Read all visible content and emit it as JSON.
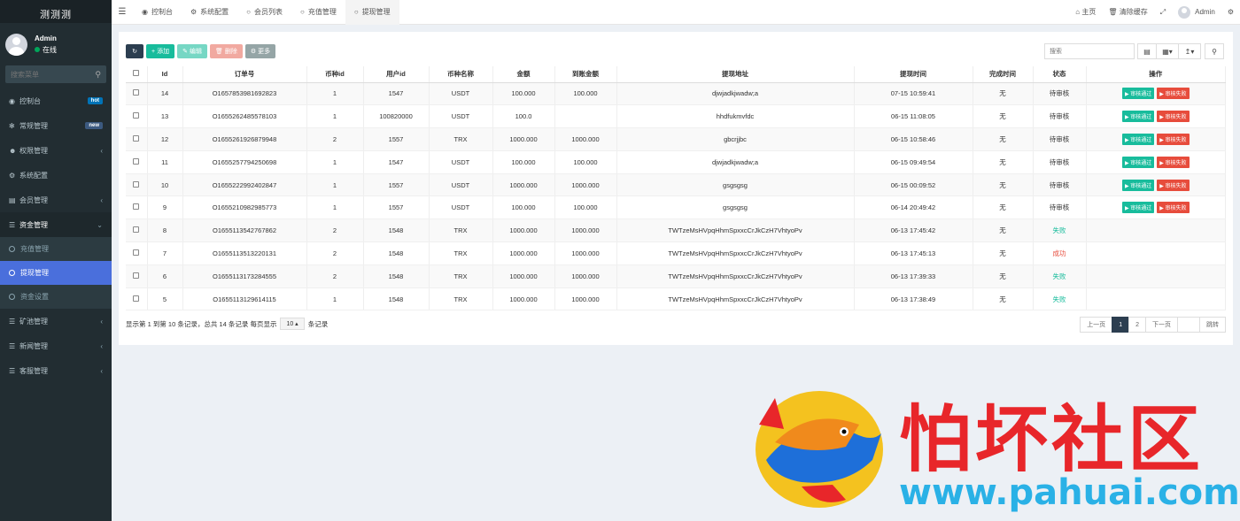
{
  "sidebar": {
    "logo": "测测测",
    "user_name": "Admin",
    "user_status": "在线",
    "search_placeholder": "搜索菜单",
    "menu": [
      {
        "label": "控制台",
        "badge": "hot"
      },
      {
        "label": "常规管理",
        "badge": "new"
      },
      {
        "label": "权限管理"
      },
      {
        "label": "系统配置"
      },
      {
        "label": "会员管理"
      },
      {
        "label": "资金管理"
      }
    ],
    "submenu": [
      "充值管理",
      "提现管理",
      "资金设置"
    ],
    "menu2": [
      "矿池管理",
      "新闻管理",
      "客服管理"
    ]
  },
  "topbar": {
    "tabs": [
      "控制台",
      "系统配置",
      "会员列表",
      "充值管理",
      "提现管理"
    ],
    "home": "主页",
    "clear_cache": "清除缓存",
    "admin": "Admin"
  },
  "toolbar": {
    "add": "添加",
    "edit": "编辑",
    "delete": "删除",
    "more": "更多",
    "search_placeholder": "搜索"
  },
  "table": {
    "headers": [
      "Id",
      "订单号",
      "币种id",
      "用户id",
      "币种名称",
      "金额",
      "到账金额",
      "提现地址",
      "提现时间",
      "完成时间",
      "状态",
      "操作"
    ],
    "rows": [
      {
        "id": "14",
        "order": "O1657853981692823",
        "coin_id": "1",
        "user_id": "1547",
        "coin": "USDT",
        "amount": "100.000",
        "received": "100.000",
        "address": "djwjadkjwadw;a",
        "time": "07-15 10:59:41",
        "done": "无",
        "status": "待审核",
        "pending": true
      },
      {
        "id": "13",
        "order": "O1655262485578103",
        "coin_id": "1",
        "user_id": "100820000",
        "coin": "USDT",
        "amount": "100.0",
        "received": "",
        "address": "hhdfukmvfdc",
        "time": "06-15 11:08:05",
        "done": "无",
        "status": "待审核",
        "pending": true
      },
      {
        "id": "12",
        "order": "O1655261926879948",
        "coin_id": "2",
        "user_id": "1557",
        "coin": "TRX",
        "amount": "1000.000",
        "received": "1000.000",
        "address": "gbcrjjbc",
        "time": "06-15 10:58:46",
        "done": "无",
        "status": "待审核",
        "pending": true
      },
      {
        "id": "11",
        "order": "O1655257794250698",
        "coin_id": "1",
        "user_id": "1547",
        "coin": "USDT",
        "amount": "100.000",
        "received": "100.000",
        "address": "djwjadkjwadw;a",
        "time": "06-15 09:49:54",
        "done": "无",
        "status": "待审核",
        "pending": true
      },
      {
        "id": "10",
        "order": "O1655222992402847",
        "coin_id": "1",
        "user_id": "1557",
        "coin": "USDT",
        "amount": "1000.000",
        "received": "1000.000",
        "address": "gsgsgsg",
        "time": "06-15 00:09:52",
        "done": "无",
        "status": "待审核",
        "pending": true
      },
      {
        "id": "9",
        "order": "O1655210982985773",
        "coin_id": "1",
        "user_id": "1557",
        "coin": "USDT",
        "amount": "100.000",
        "received": "100.000",
        "address": "gsgsgsg",
        "time": "06-14 20:49:42",
        "done": "无",
        "status": "待审核",
        "pending": true
      },
      {
        "id": "8",
        "order": "O1655113542767862",
        "coin_id": "2",
        "user_id": "1548",
        "coin": "TRX",
        "amount": "1000.000",
        "received": "1000.000",
        "address": "TWTzeMsHVpqHhmSpxxcCrJkCzH7VhtyoPv",
        "time": "06-13 17:45:42",
        "done": "无",
        "status": "失败",
        "pending": false,
        "fail": true
      },
      {
        "id": "7",
        "order": "O1655113513220131",
        "coin_id": "2",
        "user_id": "1548",
        "coin": "TRX",
        "amount": "1000.000",
        "received": "1000.000",
        "address": "TWTzeMsHVpqHhmSpxxcCrJkCzH7VhtyoPv",
        "time": "06-13 17:45:13",
        "done": "无",
        "status": "成功",
        "pending": false,
        "fail": false
      },
      {
        "id": "6",
        "order": "O1655113173284555",
        "coin_id": "2",
        "user_id": "1548",
        "coin": "TRX",
        "amount": "1000.000",
        "received": "1000.000",
        "address": "TWTzeMsHVpqHhmSpxxcCrJkCzH7VhtyoPv",
        "time": "06-13 17:39:33",
        "done": "无",
        "status": "失败",
        "pending": false,
        "fail": true
      },
      {
        "id": "5",
        "order": "O1655113129614115",
        "coin_id": "1",
        "user_id": "1548",
        "coin": "TRX",
        "amount": "1000.000",
        "received": "1000.000",
        "address": "TWTzeMsHVpqHhmSpxxcCrJkCzH7VhtyoPv",
        "time": "06-13 17:38:49",
        "done": "无",
        "status": "失败",
        "pending": false,
        "fail": true
      }
    ],
    "approve": "▶ 审核通过",
    "reject": "▶ 审核失败"
  },
  "footer": {
    "info": "显示第 1 到第 10 条记录，总共 14 条记录 每页显示",
    "page_size": "10 ▴",
    "suffix": "条记录",
    "prev": "上一页",
    "pages": [
      "1",
      "2"
    ],
    "next": "下一页",
    "jump": "跳转"
  },
  "watermark": {
    "title": "怕坏社区",
    "url": "www.pahuai.com"
  },
  "colors": {
    "sidebar": "#222d32",
    "active": "#4a6fdc",
    "green": "#18bc9c",
    "red": "#e74c3c"
  }
}
